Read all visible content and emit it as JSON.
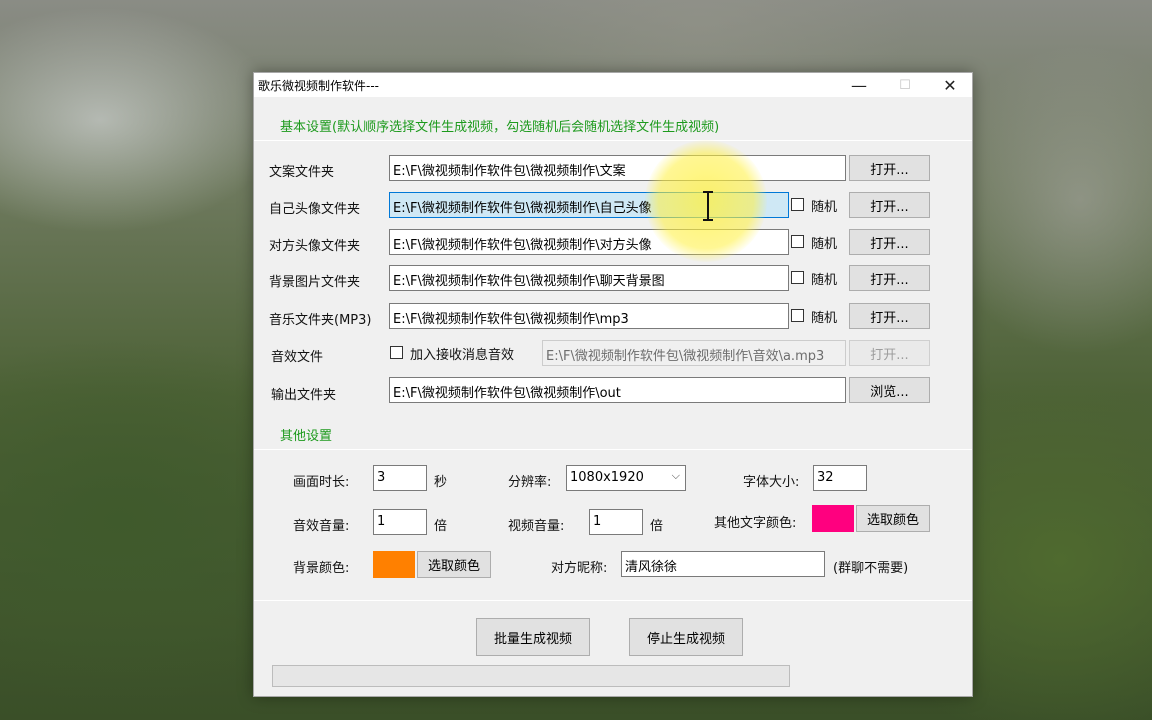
{
  "window": {
    "title": "歌乐微视频制作软件---",
    "minimize": "—",
    "maximize": "☐",
    "close": "✕"
  },
  "basic": {
    "heading": "基本设置(默认顺序选择文件生成视频，勾选随机后会随机选择文件生成视频)",
    "rows": [
      {
        "label": "文案文件夹",
        "value": "E:\\F\\微视频制作软件包\\微视频制作\\文案",
        "open": "打开..."
      },
      {
        "label": "自己头像文件夹",
        "value": "E:\\F\\微视频制作软件包\\微视频制作\\自己头像",
        "random": "随机",
        "open": "打开..."
      },
      {
        "label": "对方头像文件夹",
        "value": "E:\\F\\微视频制作软件包\\微视频制作\\对方头像",
        "random": "随机",
        "open": "打开..."
      },
      {
        "label": "背景图片文件夹",
        "value": "E:\\F\\微视频制作软件包\\微视频制作\\聊天背景图",
        "random": "随机",
        "open": "打开..."
      },
      {
        "label": "音乐文件夹(MP3)",
        "value": "E:\\F\\微视频制作软件包\\微视频制作\\mp3",
        "random": "随机",
        "open": "打开..."
      }
    ],
    "sound": {
      "label": "音效文件",
      "checkbox": "加入接收消息音效",
      "value": "E:\\F\\微视频制作软件包\\微视频制作\\音效\\a.mp3",
      "open": "打开..."
    },
    "output": {
      "label": "输出文件夹",
      "value": "E:\\F\\微视频制作软件包\\微视频制作\\out",
      "browse": "浏览..."
    }
  },
  "other": {
    "heading": "其他设置",
    "duration": {
      "label": "画面时长:",
      "value": "3",
      "unit": "秒"
    },
    "resolution": {
      "label": "分辨率:",
      "value": "1080x1920"
    },
    "font_size": {
      "label": "字体大小:",
      "value": "32"
    },
    "sfx_volume": {
      "label": "音效音量:",
      "value": "1",
      "unit": "倍"
    },
    "video_volume": {
      "label": "视频音量:",
      "value": "1",
      "unit": "倍"
    },
    "other_text_color": {
      "label": "其他文字颜色:",
      "color": "#ff007f",
      "button": "选取颜色"
    },
    "bg_color": {
      "label": "背景颜色:",
      "color": "#ff8000",
      "button": "选取颜色"
    },
    "nickname": {
      "label": "对方昵称:",
      "value": "清风徐徐",
      "note": "(群聊不需要)"
    }
  },
  "actions": {
    "batch": "批量生成视频",
    "stop": "停止生成视频"
  },
  "progress": {
    "value": 0
  },
  "colors": {
    "section_green": "#1d9a1d",
    "selection_blue": "#cfe8f5"
  }
}
